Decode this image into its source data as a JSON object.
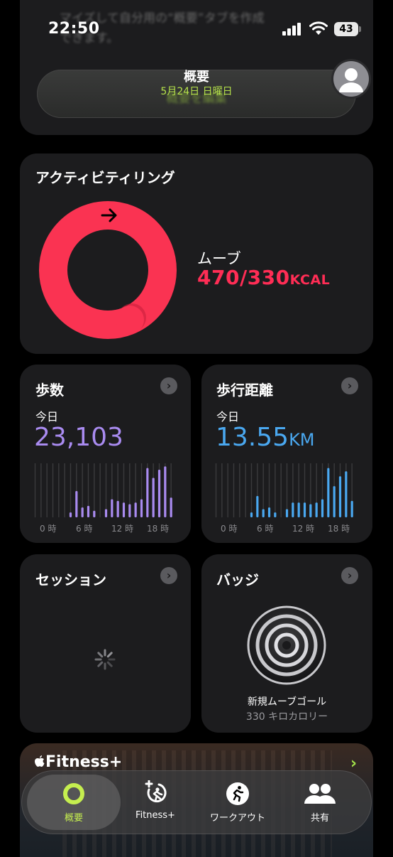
{
  "status": {
    "time": "22:50",
    "battery": "43"
  },
  "header": {
    "blurred_text_line1": "マイズして自分用の“概要”タブを作成",
    "blurred_text_line2": "できます。",
    "blurred_button": "概要を編集",
    "title": "概要",
    "date": "5月24日 日曜日"
  },
  "activity": {
    "title": "アクティビティリング",
    "move_label": "ムーブ",
    "move_value": "470/330",
    "move_unit": "KCAL",
    "move_percent": 142,
    "ring_color": "#fa3352"
  },
  "steps": {
    "title": "歩数",
    "period": "今日",
    "value": "23,103",
    "color": "#a98bf0",
    "axis": [
      "0 時",
      "6 時",
      "12 時",
      "18 時"
    ],
    "hourly": [
      0,
      0,
      0,
      0,
      0,
      0,
      3,
      16,
      6,
      7,
      4,
      0,
      5,
      11,
      10,
      9,
      8,
      9,
      11,
      30,
      24,
      29,
      31,
      12
    ]
  },
  "distance": {
    "title": "歩行距離",
    "period": "今日",
    "value": "13.55",
    "unit": "KM",
    "color": "#4aa8f0",
    "axis": [
      "0 時",
      "6 時",
      "12 時",
      "18 時"
    ],
    "hourly": [
      0,
      0,
      0,
      0,
      0,
      0,
      3,
      13,
      5,
      6,
      3,
      0,
      5,
      9,
      9,
      9,
      8,
      9,
      11,
      30,
      19,
      25,
      28,
      10
    ]
  },
  "sessions": {
    "title": "セッション"
  },
  "badges": {
    "title": "バッジ",
    "badge_name": "新規ムーブゴール",
    "badge_detail": "330 キロカロリー"
  },
  "fitness_plus": {
    "label": "Fitness+"
  },
  "tabbar": {
    "tabs": [
      {
        "label": "概要",
        "icon": "activity-rings-icon",
        "selected": true,
        "color": "#c5ee4f"
      },
      {
        "label": "Fitness+",
        "icon": "fitness-plus-icon",
        "selected": false
      },
      {
        "label": "ワークアウト",
        "icon": "workout-runner-icon",
        "selected": false
      },
      {
        "label": "共有",
        "icon": "sharing-people-icon",
        "selected": false
      }
    ]
  }
}
